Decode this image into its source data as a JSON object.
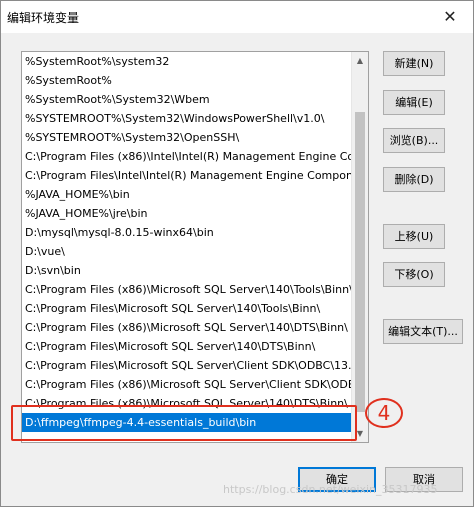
{
  "window": {
    "title": "编辑环境变量",
    "close_glyph": "✕"
  },
  "paths": [
    "%SystemRoot%\\system32",
    "%SystemRoot%",
    "%SystemRoot%\\System32\\Wbem",
    "%SYSTEMROOT%\\System32\\WindowsPowerShell\\v1.0\\",
    "%SYSTEMROOT%\\System32\\OpenSSH\\",
    "C:\\Program Files (x86)\\Intel\\Intel(R) Management Engine Co...",
    "C:\\Program Files\\Intel\\Intel(R) Management Engine Compon...",
    "%JAVA_HOME%\\bin",
    "%JAVA_HOME%\\jre\\bin",
    "D:\\mysql\\mysql-8.0.15-winx64\\bin",
    "D:\\vue\\",
    "D:\\svn\\bin",
    "C:\\Program Files (x86)\\Microsoft SQL Server\\140\\Tools\\Binn\\",
    "C:\\Program Files\\Microsoft SQL Server\\140\\Tools\\Binn\\",
    "C:\\Program Files (x86)\\Microsoft SQL Server\\140\\DTS\\Binn\\",
    "C:\\Program Files\\Microsoft SQL Server\\140\\DTS\\Binn\\",
    "C:\\Program Files\\Microsoft SQL Server\\Client SDK\\ODBC\\13...",
    "C:\\Program Files (x86)\\Microsoft SQL Server\\Client SDK\\ODB...",
    "C:\\Program Files (x86)\\Microsoft SQL Server\\140\\DTS\\Binn\\",
    "D:\\ffmpeg\\ffmpeg-4.4-essentials_build\\bin"
  ],
  "selected_index": 19,
  "scrollbar": {
    "up_glyph": "▲",
    "down_glyph": "▼"
  },
  "annotation": {
    "label": "4",
    "color": "#e0301e"
  },
  "buttons": {
    "new": "新建(N)",
    "edit": "编辑(E)",
    "browse": "浏览(B)...",
    "delete": "删除(D)",
    "move_up": "上移(U)",
    "move_down": "下移(O)",
    "edit_text": "编辑文本(T)...",
    "ok": "确定",
    "cancel": "取消"
  },
  "watermark": "https://blog.csdn.net/weixin_35317935",
  "colors": {
    "selection": "#0078d7",
    "primary_border": "#0078d7"
  }
}
